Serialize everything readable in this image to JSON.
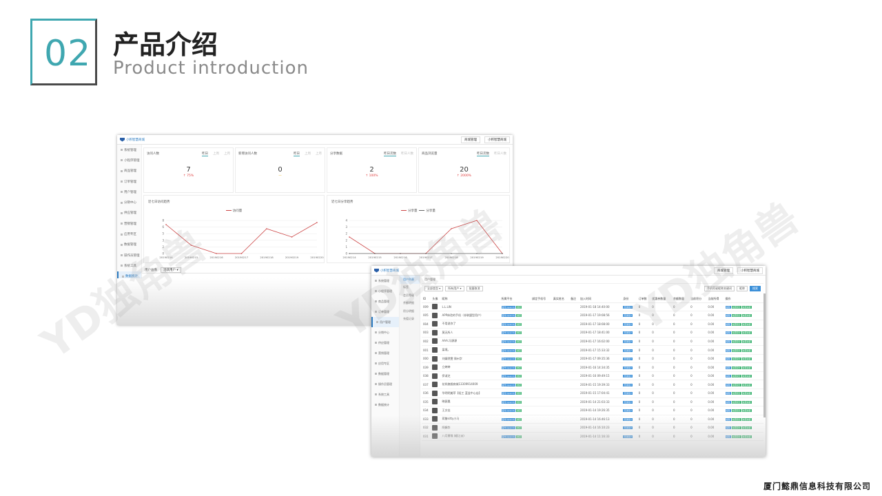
{
  "header": {
    "number": "02",
    "title_cn": "产品介绍",
    "title_en": "Product introduction"
  },
  "footer": {
    "company": "厦门懿鼎信息科技有限公司"
  },
  "watermark": {
    "text": "YD独角兽"
  },
  "dashboard": {
    "app_name": "小积智慧商城",
    "top_buttons": [
      "商城管理",
      "小积智慧商城"
    ],
    "sidebar": [
      "系统管理",
      "小程序管理",
      "商品管理",
      "订单管理",
      "用户管理",
      "分销中心",
      "供应管理",
      "营销管理",
      "应用专区",
      "数据管理",
      "操作员管理",
      "系统工具",
      "数据统计"
    ],
    "cards": [
      {
        "title": "访问人数",
        "tabs": [
          "昨日",
          "上周",
          "上月"
        ],
        "value": "7",
        "change": "↑ 75%",
        "color": "#e04040"
      },
      {
        "title": "新增访问人数",
        "tabs": [
          "昨日",
          "上周",
          "上月"
        ],
        "value": "0",
        "change": "—",
        "color": "#e8b000"
      },
      {
        "title": "分享数据",
        "tabs": [
          "昨日次数",
          "昨日人数"
        ],
        "value": "2",
        "change": "↑ 100%",
        "color": "#e04040"
      },
      {
        "title": "商品浏览量",
        "tabs": [
          "昨日次数",
          "昨日人数"
        ],
        "value": "20",
        "change": "↑ 2000%",
        "color": "#e04040"
      }
    ],
    "chart1_title": "近七日访问趋势",
    "chart2_title": "近七日分享趋势",
    "bottom_label": "用户画像",
    "bottom_select": "活跃用户 ▾"
  },
  "chart_data": [
    {
      "type": "line",
      "title": "近七日访问趋势",
      "categories": [
        "20190214",
        "20190215",
        "20190216",
        "20190217",
        "20190218",
        "20190219",
        "20190220"
      ],
      "series": [
        {
          "name": "访问量",
          "values": [
            7,
            2,
            0,
            0,
            6,
            4,
            7.5
          ]
        }
      ],
      "ylim": [
        0,
        8
      ]
    },
    {
      "type": "line",
      "title": "近七日分享趋势",
      "categories": [
        "20190214",
        "20190215",
        "20190216",
        "20190217",
        "20190218",
        "20190219",
        "20190220"
      ],
      "series": [
        {
          "name": "分享量",
          "values": [
            2,
            0,
            0,
            0,
            3,
            4,
            0
          ]
        },
        {
          "name": "分享量",
          "values": [
            0,
            0,
            0,
            0,
            0,
            0,
            0
          ]
        }
      ],
      "ylim": [
        0,
        4
      ]
    }
  ],
  "users": {
    "app_name": "小积智慧商城",
    "top_buttons": [
      "商城管理",
      "小积智慧商城"
    ],
    "sidebar": [
      "系统管理",
      "小程序管理",
      "商品管理",
      "订单管理",
      "用户管理",
      "分销中心",
      "供应管理",
      "营销管理",
      "应用专区",
      "数据管理",
      "操作员管理",
      "系统工具",
      "数据统计"
    ],
    "submenu": [
      "用户列表",
      "标签",
      "会员等级",
      "余额明细",
      "积分明细",
      "充值记录"
    ],
    "crumb": "用户管理",
    "filters": [
      "全部类型 ▾",
      "所有用户 ▾",
      "批量取消"
    ],
    "search_placeholder": "手机号或昵称关键词",
    "search_value": "昵称",
    "search_btn": "搜索",
    "columns": [
      "ID",
      "头像",
      "昵称",
      "所属平台",
      "绑定手机号",
      "真实姓名",
      "备注",
      "加入时间",
      "身份",
      "订单数",
      "优惠券数量",
      "余额数量",
      "当前积分",
      "当前所得",
      "操作"
    ],
    "rows": [
      [
        "009",
        "L.L.LIN",
        "2019-01-18 14:40:00"
      ],
      [
        "005",
        "APP体验的手机（非联盟型用户）",
        "2019-01-17 19:08:56"
      ],
      [
        "004",
        "不用说你了",
        "2019-01-17 18:08:00"
      ],
      [
        "003",
        "莫无所人",
        "2019-01-17 18:41:00"
      ],
      [
        "002",
        "AAA.冯源源",
        "2019-01-17 16:02:00"
      ],
      [
        "001",
        "梁境。",
        "2019-01-17 15:33:32"
      ],
      [
        "000",
        "刘婧然雯 周州字",
        "2019-01-17 09:35:36"
      ],
      [
        "039",
        "立婷婷",
        "2019-01-16 14:34:35"
      ],
      [
        "038",
        "伊淑芝",
        "2019-01-16 09:49:15"
      ],
      [
        "037",
        "花样旗舰商城13309914009",
        "2019-01-15 19:39:33"
      ],
      [
        "036",
        "华明明美萃【轻工 蓝益中心店】",
        "2019-01-15 17:04:41"
      ],
      [
        "035",
        "晓瑟凰",
        "2019-01-14 21:03:33"
      ],
      [
        "034",
        "王文佳",
        "2019-01-14 19:26:35"
      ],
      [
        "033",
        "蒋鲁kitty小马",
        "2019-01-14 16:46:13"
      ],
      [
        "032",
        "阿娟华",
        "2019-01-14 16:10:23"
      ],
      [
        "031",
        "八月萧哉 (顺江派)",
        "2019-01-14 11:16:33"
      ]
    ],
    "platform": "官方(openid)",
    "bind": "绑定",
    "role": "普通用户",
    "zero": "0",
    "money": "0.00",
    "ops": [
      "编辑",
      "充值积分",
      "充值余额"
    ]
  }
}
